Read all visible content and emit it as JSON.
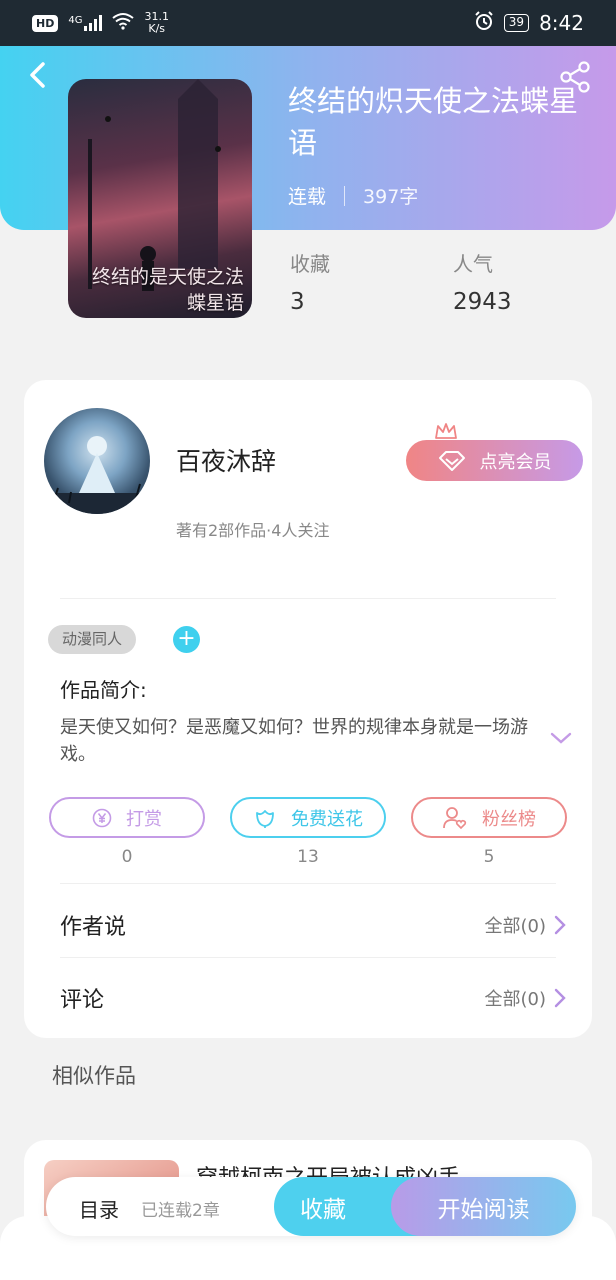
{
  "status_bar": {
    "hd": "HD",
    "network": "4G",
    "speed_value": "31.1",
    "speed_unit": "K/s",
    "battery": "39",
    "time": "8:42"
  },
  "header": {
    "back_icon": "chevron-left-icon",
    "share_icon": "share-icon"
  },
  "book": {
    "title": "终结的炽天使之法蝶星语",
    "cover_text": "终结的是天使之法蝶星语",
    "status": "连载",
    "word_count": "397字",
    "stats": [
      {
        "label": "收藏",
        "value": "3"
      },
      {
        "label": "人气",
        "value": "2943"
      }
    ]
  },
  "author": {
    "name": "百夜沐辞",
    "subtitle": "著有2部作品·4人关注",
    "vip_label": "点亮会员"
  },
  "tags": [
    "动漫同人"
  ],
  "tag_add": "+",
  "intro": {
    "title": "作品简介:",
    "text": "是天使又如何？是恶魔又如何？世界的规律本身就是一场游戏。"
  },
  "actions": [
    {
      "label": "打赏",
      "count": "0",
      "color": "#c49be6"
    },
    {
      "label": "免费送花",
      "count": "13",
      "color": "#4ccfee"
    },
    {
      "label": "粉丝榜",
      "count": "5",
      "color": "#ec8a8a"
    }
  ],
  "rows": [
    {
      "title": "作者说",
      "right": "全部(0)"
    },
    {
      "title": "评论",
      "right": "全部(0)"
    }
  ],
  "similar": {
    "title": "相似作品",
    "book_title": "穿越柯南之开局被认成凶手"
  },
  "bottom": {
    "toc": "目录",
    "toc_sub": "已连载2章",
    "favorite": "收藏",
    "read": "开始阅读"
  },
  "colors": {
    "accent_cyan": "#44d2f1",
    "accent_purple": "#c69aea",
    "accent_pink": "#f08585"
  }
}
